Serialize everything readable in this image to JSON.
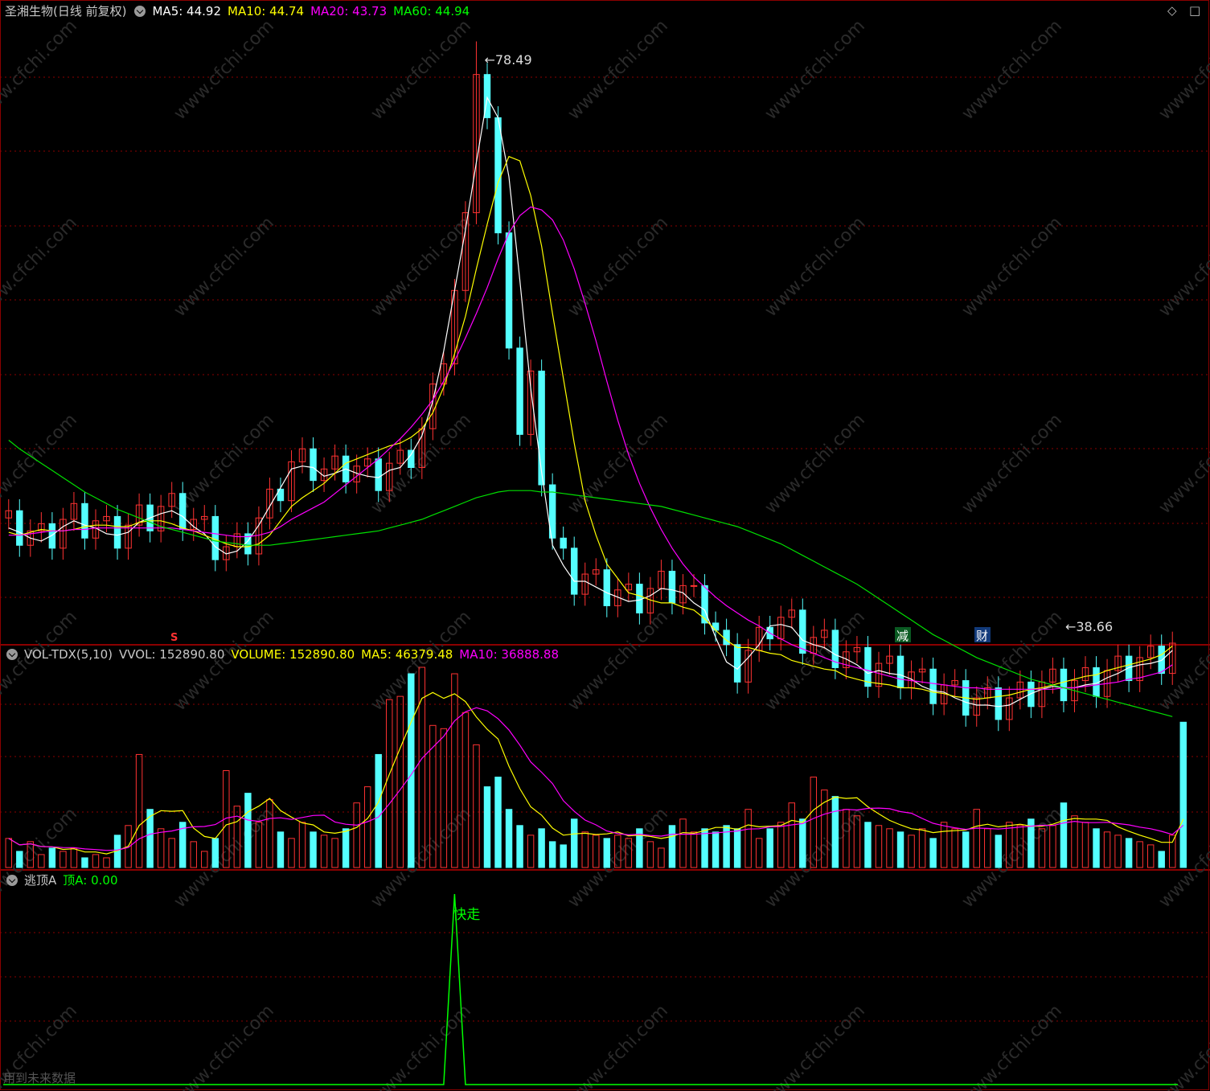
{
  "price_header": {
    "stock": "圣湘生物(日线 前复权)",
    "ma5_label": "MA5: 44.92",
    "ma10_label": "MA10: 44.74",
    "ma20_label": "MA20: 43.73",
    "ma60_label": "MA60: 44.94"
  },
  "vol_header": {
    "name": "VOL-TDX(5,10)",
    "vvol_label": "VVOL: 152890.80",
    "volume_label": "VOLUME: 152890.80",
    "ma5_label": "MA5: 46379.48",
    "ma10_label": "MA10: 36888.88"
  },
  "ind_header": {
    "name": "逃顶A",
    "value_label": "顶A: 0.00"
  },
  "markers": {
    "high_label": "78.49",
    "low_label": "38.66",
    "s_marker": "S",
    "jian_marker": "减",
    "cai_marker": "财",
    "kuaizou": "快走"
  },
  "corner_icons": [
    "diamond-icon",
    "square-icon"
  ],
  "footnote": "用到未来数据",
  "watermark": "www.cfchi.com",
  "colors": {
    "up": "#ff3232",
    "down": "#54ffff",
    "ma5": "#ffffff",
    "ma10": "#ffff00",
    "ma20": "#ff00ff",
    "ma60": "#00e000",
    "grid": "#8b0000",
    "signal": "#00ff00"
  },
  "chart_data": [
    {
      "type": "candlestick",
      "title": "圣湘生物(日线 前复权)",
      "ylim": [
        37.5,
        80.5
      ],
      "series": [
        {
          "name": "MA5",
          "values": [
            45.5,
            45.2,
            44.8,
            44.6,
            45.0,
            45.6,
            46.0,
            45.7,
            45.5,
            45.1,
            45.0,
            45.2,
            45.9,
            46.2,
            46.5,
            46.7,
            46.3,
            45.6,
            45.1,
            44.2,
            43.7,
            43.9,
            44.6,
            45.7,
            47.0,
            48.3,
            49.6,
            49.8,
            49.7,
            49.1,
            49.3,
            49.6,
            49.3,
            49.1,
            49.0,
            49.5,
            49.7,
            50.6,
            51.9,
            54.3,
            57.8,
            62.0,
            66.2,
            70.9,
            75.4,
            74.0,
            69.9,
            62.7,
            55.2,
            49.4,
            44.3,
            42.9,
            41.8,
            41.8,
            41.4,
            41.0,
            40.7,
            40.4,
            40.5,
            40.8,
            41.3,
            41.2,
            41.0,
            40.3,
            39.8,
            37.9,
            36.2,
            35.7,
            36.5,
            37.4,
            38.7,
            38.8,
            38.6,
            37.7,
            37.4,
            37.2,
            36.7,
            36.4,
            36.0,
            35.4,
            35.6,
            35.4,
            35.3,
            35.0,
            34.5,
            34.2,
            34.1,
            33.7,
            33.4,
            33.2,
            33.2,
            33.1,
            33.2,
            33.6,
            34.0,
            34.3,
            34.5,
            34.4,
            34.4,
            34.6,
            34.7,
            35.1,
            35.4,
            35.8,
            36.0,
            36.1,
            36.3,
            37.0
          ]
        },
        {
          "name": "MA10",
          "values": [
            45.2,
            45.0,
            45.2,
            45.4,
            45.3,
            45.3,
            45.4,
            45.6,
            45.7,
            45.7,
            45.6,
            45.6,
            45.9,
            46.0,
            46.0,
            45.8,
            45.5,
            45.3,
            45.0,
            44.7,
            44.4,
            44.2,
            44.2,
            44.4,
            45.0,
            46.0,
            47.0,
            47.6,
            48.1,
            48.6,
            49.3,
            50.0,
            50.3,
            50.6,
            50.9,
            51.2,
            51.4,
            51.8,
            52.4,
            53.5,
            55.3,
            57.6,
            60.2,
            63.5,
            66.6,
            69.5,
            71.3,
            71.0,
            68.6,
            65.1,
            60.4,
            55.9,
            51.4,
            47.4,
            45.0,
            43.0,
            42.0,
            41.0,
            40.8,
            40.5,
            40.3,
            40.3,
            40.0,
            39.8,
            39.2,
            38.4,
            37.7,
            37.2,
            37.2,
            37.0,
            36.8,
            36.7,
            36.3,
            36.1,
            35.9,
            35.7,
            35.6,
            35.2,
            35.0,
            34.8,
            34.7,
            34.6,
            34.4,
            34.4,
            34.3,
            34.1,
            34.0,
            33.8,
            33.7,
            33.6,
            33.7,
            33.8,
            33.9,
            34.1,
            34.3,
            34.4,
            34.6,
            34.8,
            35.0,
            35.2,
            35.3,
            35.6,
            35.8,
            36.0,
            36.2,
            36.4,
            36.7,
            37.3
          ]
        },
        {
          "name": "MA20",
          "values": [
            45.0,
            45.0,
            45.1,
            45.2,
            45.3,
            45.3,
            45.4,
            45.4,
            45.5,
            45.5,
            45.5,
            45.5,
            45.5,
            45.5,
            45.5,
            45.5,
            45.4,
            45.3,
            45.2,
            45.1,
            45.0,
            44.9,
            44.9,
            45.0,
            45.2,
            45.6,
            46.1,
            46.5,
            46.9,
            47.3,
            47.9,
            48.5,
            49.1,
            49.7,
            50.3,
            51.0,
            51.7,
            52.5,
            53.4,
            54.4,
            55.7,
            57.1,
            58.7,
            60.4,
            62.2,
            64.2,
            66.0,
            67.2,
            67.8,
            67.6,
            66.9,
            65.5,
            63.5,
            61.1,
            58.5,
            55.7,
            53.0,
            50.6,
            48.6,
            46.9,
            45.4,
            44.1,
            43.0,
            42.1,
            41.4,
            40.7,
            40.1,
            39.6,
            39.1,
            38.7,
            38.2,
            37.8,
            37.4,
            37.1,
            36.8,
            36.5,
            36.2,
            36.0,
            35.8,
            35.6,
            35.4,
            35.2,
            35.0,
            34.9,
            34.8,
            34.7,
            34.6,
            34.5,
            34.4,
            34.4,
            34.3,
            34.3,
            34.3,
            34.3,
            34.3,
            34.3,
            34.3,
            34.4,
            34.4,
            34.5,
            34.6,
            34.7,
            34.8,
            35.0,
            35.1,
            35.3,
            35.5,
            36.0
          ]
        },
        {
          "name": "MA60",
          "values": [
            51.6,
            51.0,
            50.5,
            50.0,
            49.5,
            49.0,
            48.5,
            48.0,
            47.6,
            47.2,
            46.8,
            46.5,
            46.2,
            45.9,
            45.6,
            45.4,
            45.2,
            45.0,
            44.8,
            44.6,
            44.5,
            44.4,
            44.3,
            44.3,
            44.3,
            44.4,
            44.5,
            44.6,
            44.7,
            44.8,
            44.9,
            45.0,
            45.1,
            45.2,
            45.3,
            45.5,
            45.7,
            45.9,
            46.1,
            46.4,
            46.7,
            47.0,
            47.3,
            47.6,
            47.8,
            48.0,
            48.1,
            48.1,
            48.1,
            48.0,
            48.0,
            47.9,
            47.8,
            47.7,
            47.6,
            47.5,
            47.4,
            47.3,
            47.2,
            47.1,
            47.0,
            46.8,
            46.6,
            46.4,
            46.2,
            46.0,
            45.8,
            45.6,
            45.3,
            45.0,
            44.7,
            44.4,
            44.0,
            43.6,
            43.2,
            42.8,
            42.4,
            42.0,
            41.6,
            41.1,
            40.6,
            40.1,
            39.6,
            39.1,
            38.6,
            38.1,
            37.7,
            37.3,
            36.9,
            36.5,
            36.2,
            35.9,
            35.6,
            35.3,
            35.0,
            34.8,
            34.6,
            34.4,
            34.2,
            34.0,
            33.8,
            33.6,
            33.4,
            33.2,
            33.0,
            32.8,
            32.6,
            32.4
          ]
        }
      ],
      "annotations": [
        {
          "text": "78.49",
          "value": 78.49
        },
        {
          "text": "38.66",
          "value": 38.66
        }
      ]
    },
    {
      "type": "bar",
      "title": "VOL-TDX(5,10)",
      "values": [
        9000,
        5000,
        8000,
        4000,
        6000,
        5000,
        6000,
        3000,
        4000,
        3000,
        10000,
        13000,
        35000,
        18000,
        12000,
        9000,
        14000,
        8000,
        5000,
        9000,
        30000,
        19000,
        23000,
        14000,
        21000,
        11000,
        9000,
        14000,
        11000,
        10000,
        9000,
        12000,
        20000,
        25000,
        35000,
        52000,
        53000,
        60000,
        62000,
        44000,
        43000,
        60000,
        48000,
        38000,
        25000,
        28000,
        18000,
        13000,
        10000,
        12000,
        8000,
        7000,
        15000,
        11000,
        10000,
        9000,
        10000,
        9000,
        12000,
        8000,
        6000,
        13000,
        15000,
        11000,
        12000,
        11000,
        13000,
        12000,
        18000,
        9000,
        12000,
        14000,
        20000,
        15000,
        28000,
        24000,
        22000,
        18000,
        16000,
        14000,
        13000,
        12000,
        11000,
        10000,
        12000,
        9000,
        14000,
        12000,
        11000,
        18000,
        12000,
        10000,
        14000,
        13000,
        15000,
        12000,
        13000,
        20000,
        16000,
        14000,
        12000,
        11000,
        10000,
        9000,
        8000,
        7000,
        5000,
        10000,
        45000
      ],
      "series": [
        {
          "name": "VOLUME",
          "value": 152890.8
        },
        {
          "name": "MA5",
          "value": 46379.48
        },
        {
          "name": "MA10",
          "value": 36888.88
        }
      ]
    },
    {
      "type": "line",
      "title": "逃顶A",
      "series": [
        {
          "name": "顶A",
          "value": 0.0,
          "peak_index": 41
        }
      ]
    }
  ]
}
